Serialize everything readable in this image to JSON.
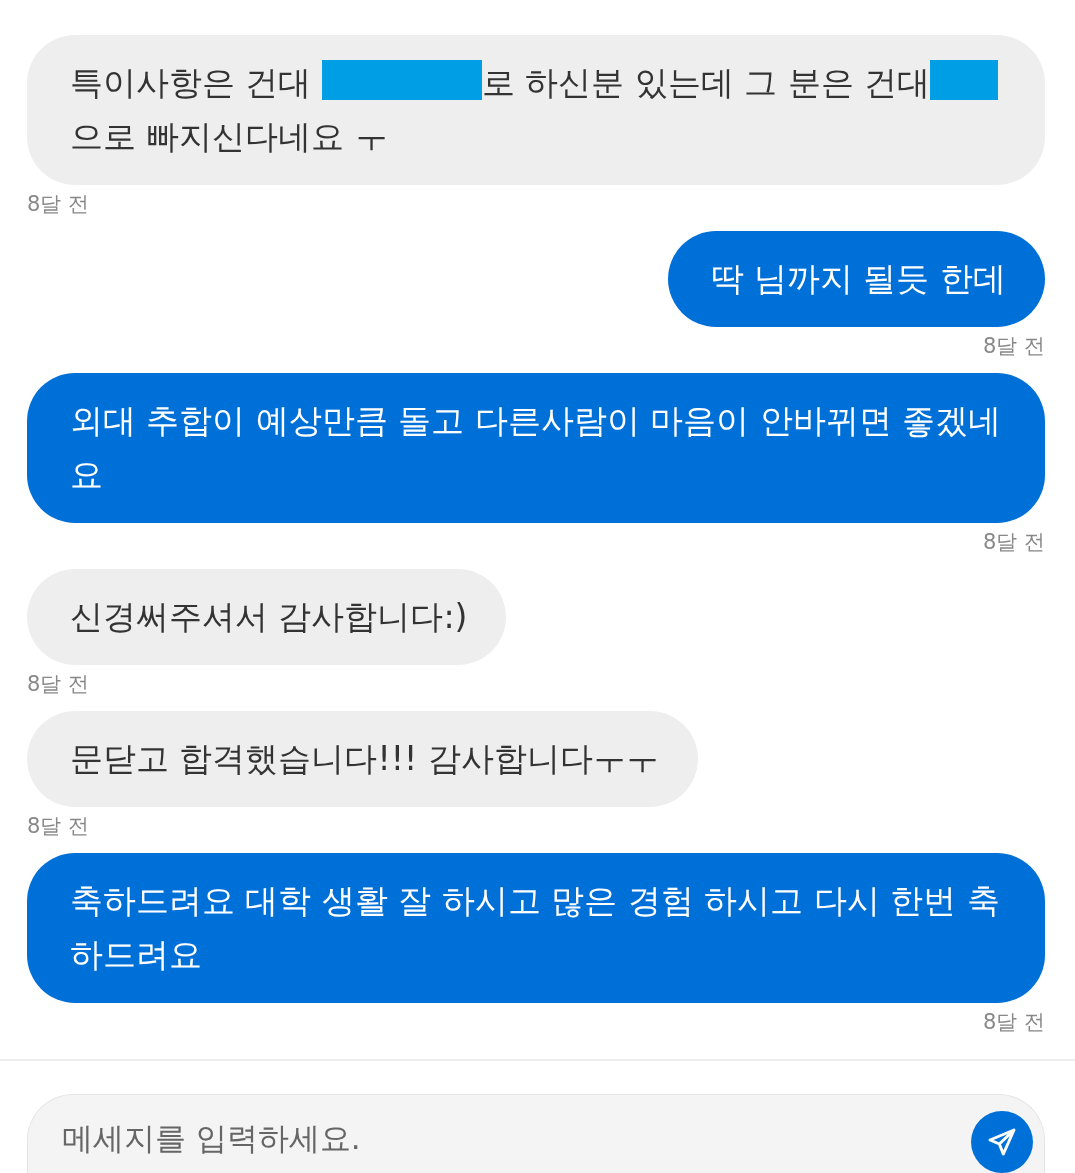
{
  "messages": [
    {
      "kind": "received",
      "parts": [
        {
          "kind": "text",
          "text": "특이사항은 건대 "
        },
        {
          "kind": "redaction_long"
        },
        {
          "kind": "text",
          "text": "로 하신분 있는데 그 분은 건대"
        },
        {
          "kind": "redaction_short"
        },
        {
          "kind": "text",
          "text": "으로 빠지신다네요 ㅜ"
        }
      ],
      "time": "8달 전"
    },
    {
      "kind": "sent",
      "parts": [
        {
          "kind": "text",
          "text": "딱 님까지 될듯 한데"
        }
      ],
      "time": "8달 전"
    },
    {
      "kind": "sent",
      "parts": [
        {
          "kind": "text",
          "text": "외대 추합이 예상만큼 돌고 다른사람이 마음이 안바뀌면 좋겠네요"
        }
      ],
      "time": "8달 전"
    },
    {
      "kind": "received",
      "parts": [
        {
          "kind": "text",
          "text": "신경써주셔서 감사합니다:)"
        }
      ],
      "time": "8달 전"
    },
    {
      "kind": "received",
      "parts": [
        {
          "kind": "text",
          "text": "문닫고 합격했습니다!!! 감사합니다ㅜㅜ"
        }
      ],
      "time": "8달 전"
    },
    {
      "kind": "sent",
      "parts": [
        {
          "kind": "text",
          "text": "축하드려요 대학 생활 잘 하시고 많은 경험 하시고 다시 한번 축하드려요"
        }
      ],
      "time": "8달 전"
    }
  ],
  "composer": {
    "placeholder": "메세지를 입력하세요."
  }
}
